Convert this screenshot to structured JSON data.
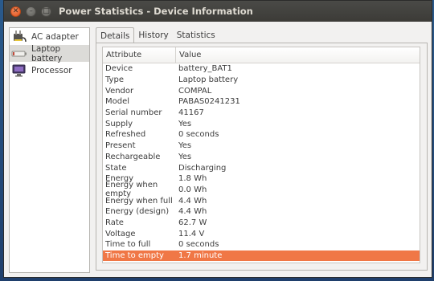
{
  "window": {
    "title": "Power Statistics - Device Information"
  },
  "sidebar": {
    "items": [
      {
        "label": "AC adapter",
        "icon": "ac-adapter-icon"
      },
      {
        "label": "Laptop battery",
        "icon": "battery-icon"
      },
      {
        "label": "Processor",
        "icon": "processor-icon"
      }
    ]
  },
  "tabs": [
    {
      "label": "Details"
    },
    {
      "label": "History"
    },
    {
      "label": "Statistics"
    }
  ],
  "table": {
    "headers": {
      "attribute": "Attribute",
      "value": "Value"
    },
    "rows": [
      {
        "attribute": "Device",
        "value": "battery_BAT1"
      },
      {
        "attribute": "Type",
        "value": "Laptop battery"
      },
      {
        "attribute": "Vendor",
        "value": "COMPAL"
      },
      {
        "attribute": "Model",
        "value": "PABAS0241231"
      },
      {
        "attribute": "Serial number",
        "value": "41167"
      },
      {
        "attribute": "Supply",
        "value": "Yes"
      },
      {
        "attribute": "Refreshed",
        "value": "0 seconds"
      },
      {
        "attribute": "Present",
        "value": "Yes"
      },
      {
        "attribute": "Rechargeable",
        "value": "Yes"
      },
      {
        "attribute": "State",
        "value": "Discharging"
      },
      {
        "attribute": "Energy",
        "value": "1.8 Wh"
      },
      {
        "attribute": "Energy when empty",
        "value": "0.0 Wh"
      },
      {
        "attribute": "Energy when full",
        "value": "4.4 Wh"
      },
      {
        "attribute": "Energy (design)",
        "value": "4.4 Wh"
      },
      {
        "attribute": "Rate",
        "value": "62.7 W"
      },
      {
        "attribute": "Voltage",
        "value": "11.4 V"
      },
      {
        "attribute": "Time to full",
        "value": "0 seconds"
      },
      {
        "attribute": "Time to empty",
        "value": "1.7 minute"
      }
    ]
  },
  "colors": {
    "accent": "#f07746",
    "titlebar": "#3c3b37",
    "close": "#e0521f"
  }
}
